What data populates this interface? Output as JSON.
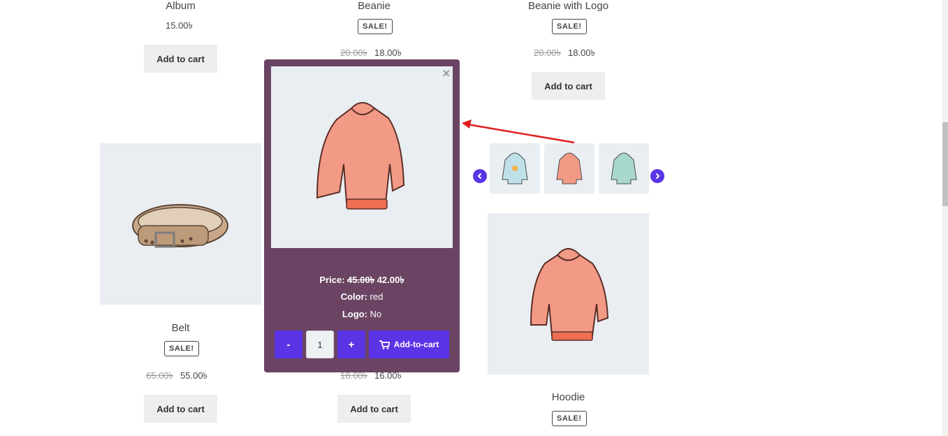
{
  "products": {
    "album": {
      "title": "Album",
      "price": "15.00৳",
      "button": "Add to cart"
    },
    "beanie": {
      "title": "Beanie",
      "sale": "SALE!",
      "old_price": "20.00৳",
      "price": "18.00৳"
    },
    "beanie_logo": {
      "title": "Beanie with Logo",
      "sale": "SALE!",
      "old_price": "20.00৳",
      "price": "18.00৳",
      "button": "Add to cart"
    },
    "belt": {
      "title": "Belt",
      "sale": "SALE!",
      "old_price": "65.00৳",
      "price": "55.00৳",
      "button": "Add to cart"
    },
    "cap": {
      "old_price": "18.00৳",
      "price": "16.00৳",
      "button": "Add to cart"
    },
    "hoodie": {
      "title": "Hoodie",
      "sale": "SALE!"
    }
  },
  "popup": {
    "close": "×",
    "price_label": "Price:",
    "old_price": "45.00৳",
    "price": "42.00৳",
    "color_label": "Color:",
    "color_value": "red",
    "logo_label": "Logo:",
    "logo_value": "No",
    "minus": "-",
    "quantity": "1",
    "plus": "+",
    "add_to_cart": "Add-to-cart"
  },
  "colors": {
    "accent": "#5b34e6",
    "popup_bg": "#6b4463",
    "arrow": "#e01e1e"
  },
  "icons": [
    "close-icon",
    "cart-icon",
    "chevron-left-icon",
    "chevron-right-icon",
    "hoodie-image",
    "belt-image"
  ]
}
